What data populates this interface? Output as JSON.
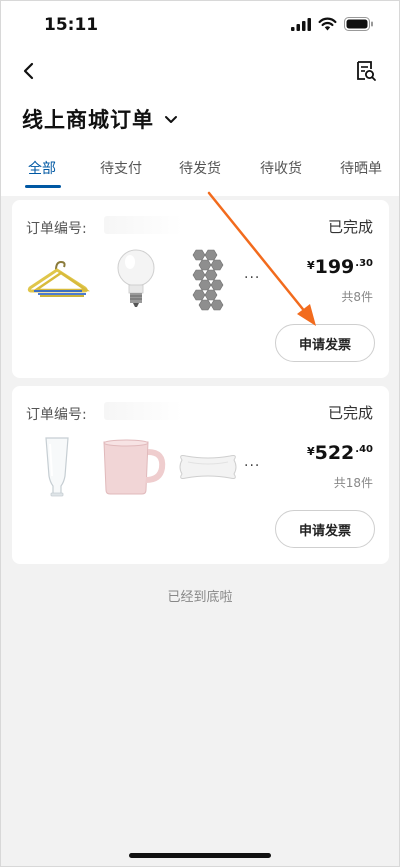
{
  "status_bar": {
    "time": "15:11"
  },
  "header": {
    "title": "线上商城订单"
  },
  "tabs": [
    {
      "label": "全部",
      "active": true
    },
    {
      "label": "待支付"
    },
    {
      "label": "待发货"
    },
    {
      "label": "待收货"
    },
    {
      "label": "待晒单"
    }
  ],
  "orders": [
    {
      "order_label": "订单编号:",
      "status": "已完成",
      "currency": "¥",
      "price_int": "199",
      "price_dec": ".30",
      "count": "共8件",
      "invoice_label": "申请发票",
      "more": "···",
      "items": [
        "hanger-product",
        "light-bulb-product",
        "hexagon-panel-product"
      ]
    },
    {
      "order_label": "订单编号:",
      "status": "已完成",
      "currency": "¥",
      "price_int": "522",
      "price_dec": ".40",
      "count": "共18件",
      "invoice_label": "申请发票",
      "more": "···",
      "items": [
        "glass-product",
        "mug-product",
        "pillow-product"
      ]
    }
  ],
  "footer": {
    "end_text": "已经到底啦"
  },
  "colors": {
    "accent": "#0058a3",
    "annotation": "#f26b1d"
  }
}
